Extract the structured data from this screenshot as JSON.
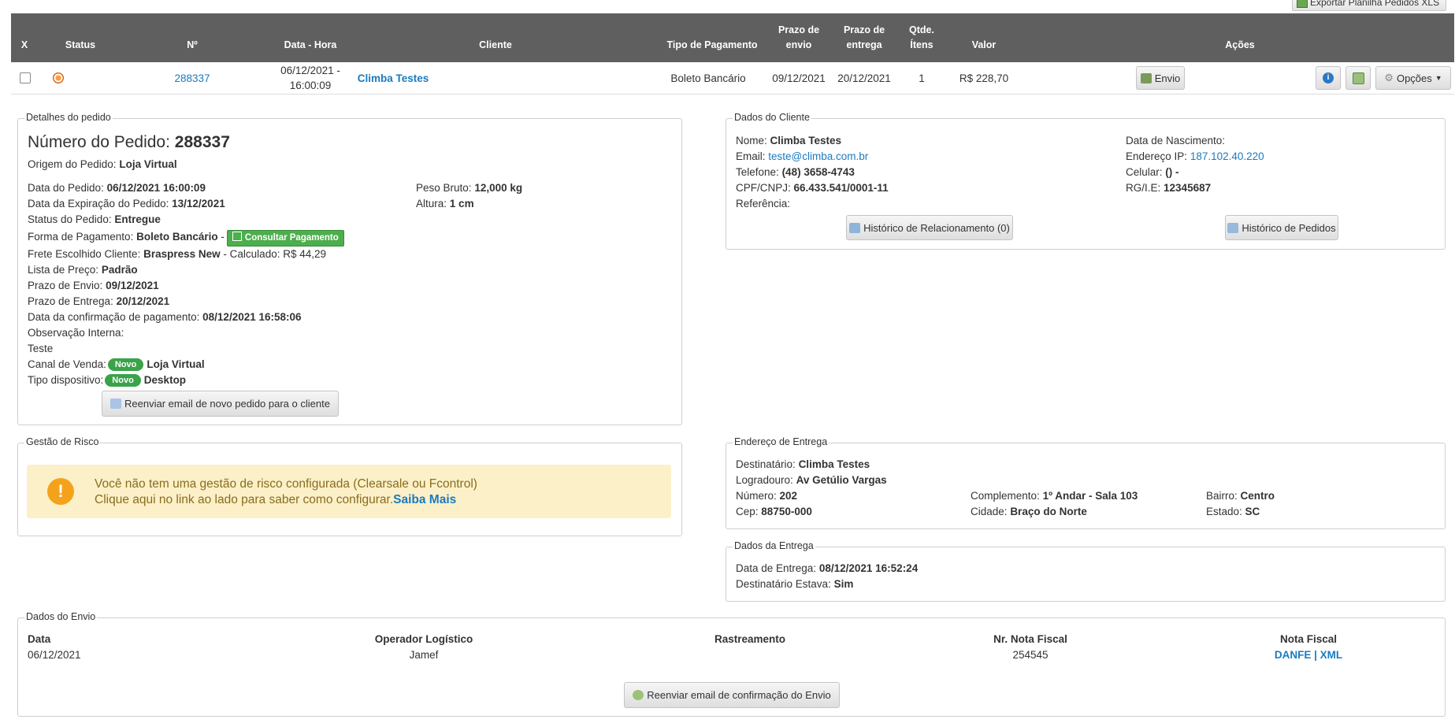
{
  "top_button": "Exportar Planilha Pedidos XLS",
  "table": {
    "headers": {
      "x": "X",
      "status": "Status",
      "num": "Nº",
      "datetime": "Data - Hora",
      "client": "Cliente",
      "payment_type": "Tipo de Pagamento",
      "ship_deadline_1": "Prazo de",
      "ship_deadline_2": "envio",
      "delivery_deadline_1": "Prazo de",
      "delivery_deadline_2": "entrega",
      "qty_1": "Qtde.",
      "qty_2": "Ítens",
      "value": "Valor",
      "actions": "Ações"
    },
    "row": {
      "order_number": "288337",
      "date_line1": "06/12/2021 -",
      "date_line2": "16:00:09",
      "client": "Climba Testes",
      "payment": "Boleto Bancário",
      "ship_deadline": "09/12/2021",
      "delivery_deadline": "20/12/2021",
      "qty": "1",
      "value": "R$ 228,70",
      "envio_button": "Envio",
      "options_button": "Opções"
    }
  },
  "order_details": {
    "legend": "Detalhes do pedido",
    "number_label": "Número do Pedido:",
    "number_value": "288337",
    "origin_label": "Origem do Pedido:",
    "origin_value": "Loja Virtual",
    "date_label": "Data do Pedido:",
    "date_value": "06/12/2021 16:00:09",
    "expiration_label": "Data da Expiração do Pedido:",
    "expiration_value": "13/12/2021",
    "status_label": "Status do Pedido:",
    "status_value": "Entregue",
    "payment_label": "Forma de Pagamento:",
    "payment_value": "Boleto Bancário",
    "payment_sep": "-",
    "consult_button": "Consultar Pagamento",
    "freight_label": "Frete Escolhido Cliente:",
    "freight_value": "Braspress New",
    "freight_calc": "- Calculado: R$ 44,29",
    "pricelist_label": "Lista de Preço:",
    "pricelist_value": "Padrão",
    "ship_label": "Prazo de Envio:",
    "ship_value": "09/12/2021",
    "delivery_label": "Prazo de Entrega:",
    "delivery_value": "20/12/2021",
    "confirm_label": "Data da confirmação de pagamento:",
    "confirm_value": "08/12/2021 16:58:06",
    "obs_label": "Observação Interna:",
    "obs_value": "Teste",
    "channel_label": "Canal de Venda:",
    "channel_badge": "Novo",
    "channel_value": "Loja Virtual",
    "device_label": "Tipo dispositivo:",
    "device_badge": "Novo",
    "device_value": "Desktop",
    "weight_label": "Peso Bruto:",
    "weight_value": "12,000 kg",
    "height_label": "Altura:",
    "height_value": "1 cm",
    "resend_button": "Reenviar email de novo pedido para o cliente"
  },
  "client_data": {
    "legend": "Dados do Cliente",
    "name_label": "Nome:",
    "name_value": "Climba Testes",
    "email_label": "Email:",
    "email_value": "teste@climba.com.br",
    "phone_label": "Telefone:",
    "phone_value": "(48) 3658-4743",
    "doc_label": "CPF/CNPJ:",
    "doc_value": "66.433.541/0001-11",
    "ref_label": "Referência:",
    "birth_label": "Data de Nascimento:",
    "ip_label": "Endereço IP:",
    "ip_value": "187.102.40.220",
    "cell_label": "Celular:",
    "cell_value": "() -",
    "rg_label": "RG/I.E:",
    "rg_value": "12345687",
    "history_rel_button": "Histórico de Relacionamento (0)",
    "history_orders_button": "Histórico de Pedidos"
  },
  "risk": {
    "legend": "Gestão de Risco",
    "line1": "Você não tem uma gestão de risco configurada (Clearsale ou Fcontrol)",
    "line2": "Clique aqui no link ao lado para saber como configurar.",
    "link": "Saiba Mais"
  },
  "address": {
    "legend": "Endereço de Entrega",
    "recipient_label": "Destinatário:",
    "recipient_value": "Climba Testes",
    "street_label": "Logradouro:",
    "street_value": "Av Getúlio Vargas",
    "number_label": "Número:",
    "number_value": "202",
    "zip_label": "Cep:",
    "zip_value": "88750-000",
    "complement_label": "Complemento:",
    "complement_value": "1º Andar - Sala 103",
    "city_label": "Cidade:",
    "city_value": "Braço do Norte",
    "district_label": "Bairro:",
    "district_value": "Centro",
    "state_label": "Estado:",
    "state_value": "SC"
  },
  "delivery": {
    "legend": "Dados da Entrega",
    "date_label": "Data de Entrega:",
    "date_value": "08/12/2021 16:52:24",
    "present_label": "Destinatário Estava:",
    "present_value": "Sim"
  },
  "shipping": {
    "legend": "Dados do Envio",
    "h_date": "Data",
    "h_operator": "Operador Logístico",
    "h_tracking": "Rastreamento",
    "h_invoice": "Nr. Nota Fiscal",
    "h_fiscal": "Nota Fiscal",
    "date": "06/12/2021",
    "operator": "Jamef",
    "invoice": "254545",
    "danfe": "DANFE",
    "sep": "|",
    "xml": "XML",
    "resend_button": "Reenviar email de confirmação do Envio"
  }
}
